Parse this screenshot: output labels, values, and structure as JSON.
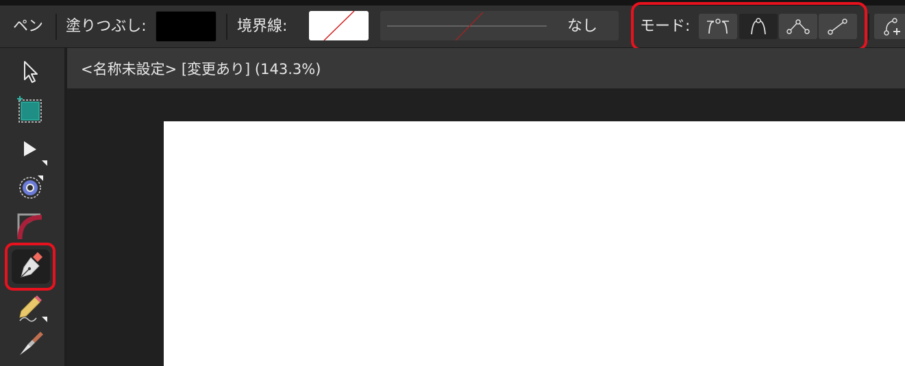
{
  "toolbar": {
    "tool_name": "ペン",
    "fill_label": "塗りつぶし:",
    "fill_color": "#000000",
    "stroke_label": "境界線:",
    "stroke_style_value": "なし",
    "mode_label": "モード:",
    "mode_buttons": [
      "pen-mode-icon",
      "smart-mode-icon",
      "polygon-mode-icon",
      "line-mode-icon"
    ],
    "active_mode": "smart-mode-icon"
  },
  "document": {
    "title": "<名称未設定> [変更あり] (143.3%)"
  },
  "tools": [
    "move-tool-icon",
    "artboard-tool-icon",
    "node-tool-icon",
    "contour-tool-icon",
    "corner-tool-icon",
    "pen-tool-icon",
    "pencil-tool-icon",
    "vector-brush-tool-icon"
  ],
  "active_tool": "pen-tool-icon",
  "colors": {
    "highlight": "#e8121e",
    "no-color-slash": "#d42020",
    "accent-teal": "#2ab5a5"
  }
}
